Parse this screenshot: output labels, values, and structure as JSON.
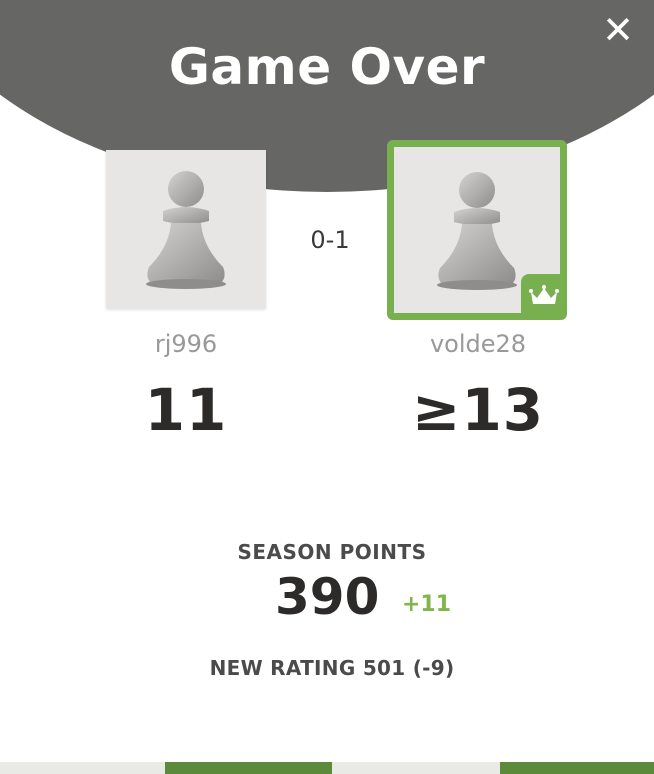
{
  "modal": {
    "title": "Game Over",
    "close_icon": "close-icon",
    "close_glyph": "✕"
  },
  "players": {
    "left": {
      "username": "rj996",
      "value": "11",
      "avatar_icon": "pawn-icon"
    },
    "right": {
      "username": "volde28",
      "value": "≥13",
      "avatar_icon": "pawn-icon",
      "badge_icon": "crown-icon",
      "winner": true
    }
  },
  "result": "0-1",
  "season": {
    "label": "SEASON POINTS",
    "points": "390",
    "delta": "+11"
  },
  "rating": {
    "text": "NEW RATING 501 (-9)"
  },
  "colors": {
    "header": "#666664",
    "accent_green": "#79b04f",
    "delta_green": "#81b64c",
    "text_dark": "#2c2b29",
    "text_muted": "#999999"
  }
}
